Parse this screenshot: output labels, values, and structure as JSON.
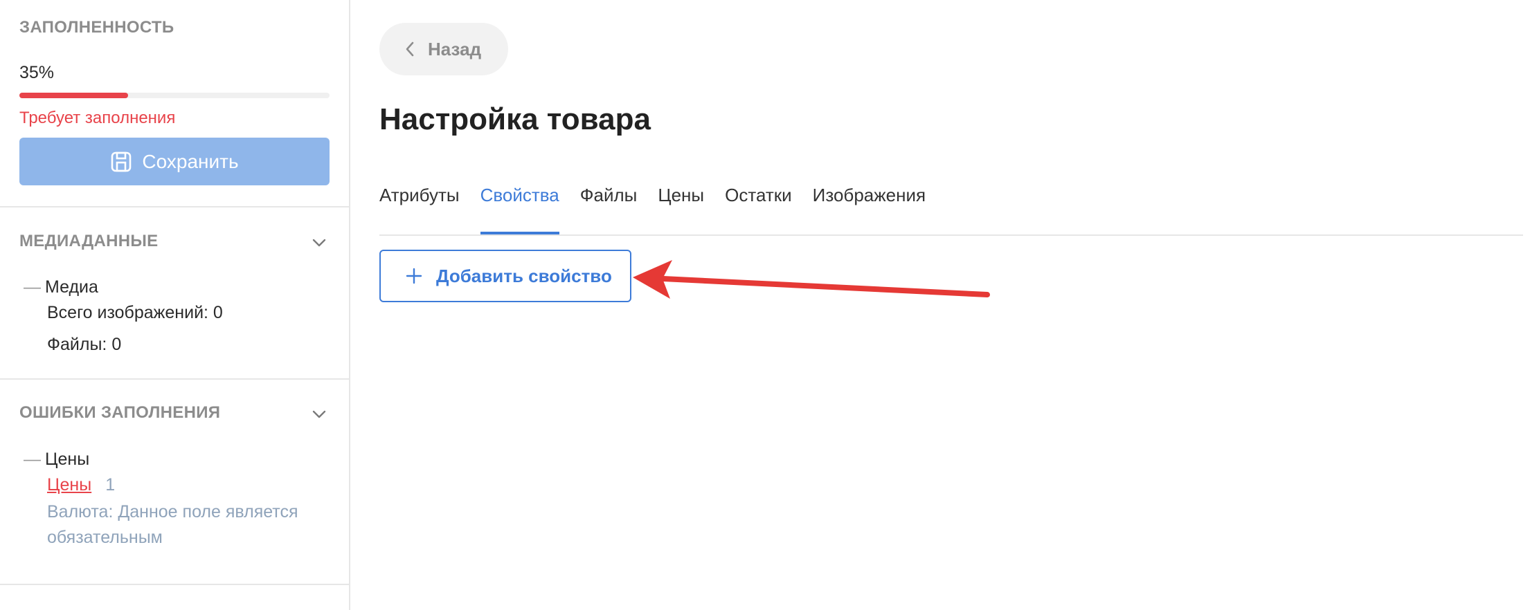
{
  "sidebar": {
    "completeness": {
      "title": "Заполненность",
      "percent_label": "35%",
      "progress_fraction": 0.35,
      "status": "Требует заполнения",
      "save_label": "Сохранить"
    },
    "media": {
      "title": "Медиаданные",
      "group": "Медиа",
      "items": [
        "Всего изображений: 0",
        "Файлы: 0"
      ]
    },
    "errors": {
      "title": "Ошибки заполнения",
      "group": "Цены",
      "link": "Цены",
      "count": "1",
      "message": "Валюта: Данное поле является обязательным"
    }
  },
  "main": {
    "back_label": "Назад",
    "title": "Настройка товара",
    "tabs": [
      "Атрибуты",
      "Свойства",
      "Файлы",
      "Цены",
      "Остатки",
      "Изображения"
    ],
    "active_tab": 1,
    "add_property_label": "Добавить свойство"
  },
  "colors": {
    "accent": "#3d7bd8",
    "error": "#e8434a",
    "save_disabled": "#8fb6ea",
    "annotation_arrow": "#e53935"
  }
}
